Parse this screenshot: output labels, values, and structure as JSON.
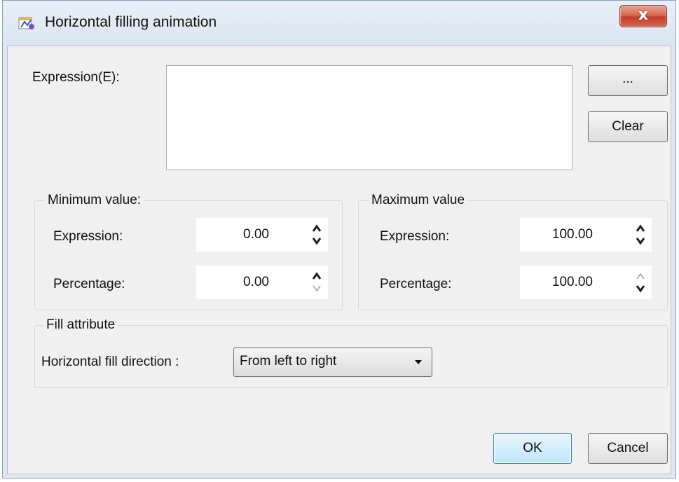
{
  "window": {
    "title": "Horizontal filling animation",
    "close_label": "x"
  },
  "expression": {
    "label": "Expression(E):",
    "value": "",
    "browse_label": "...",
    "clear_label": "Clear"
  },
  "minimum": {
    "group_title": "Minimum value:",
    "expression_label": "Expression:",
    "expression_value": "0.00",
    "percentage_label": "Percentage:",
    "percentage_value": "0.00"
  },
  "maximum": {
    "group_title": "Maximum value",
    "expression_label": "Expression:",
    "expression_value": "100.00",
    "percentage_label": "Percentage:",
    "percentage_value": "100.00"
  },
  "fill": {
    "group_title": "Fill attribute",
    "direction_label": "Horizontal fill direction :",
    "direction_value": "From left to right"
  },
  "footer": {
    "ok_label": "OK",
    "cancel_label": "Cancel"
  },
  "icons": [
    "app-icon",
    "close-icon",
    "spin-up-icon",
    "spin-down-icon",
    "dropdown-arrow-icon"
  ],
  "colors": {
    "titlebar": "#dbe5f1",
    "client": "#f0f0f0",
    "close": "#c23f2a",
    "ok_border": "#3c7fb1"
  }
}
